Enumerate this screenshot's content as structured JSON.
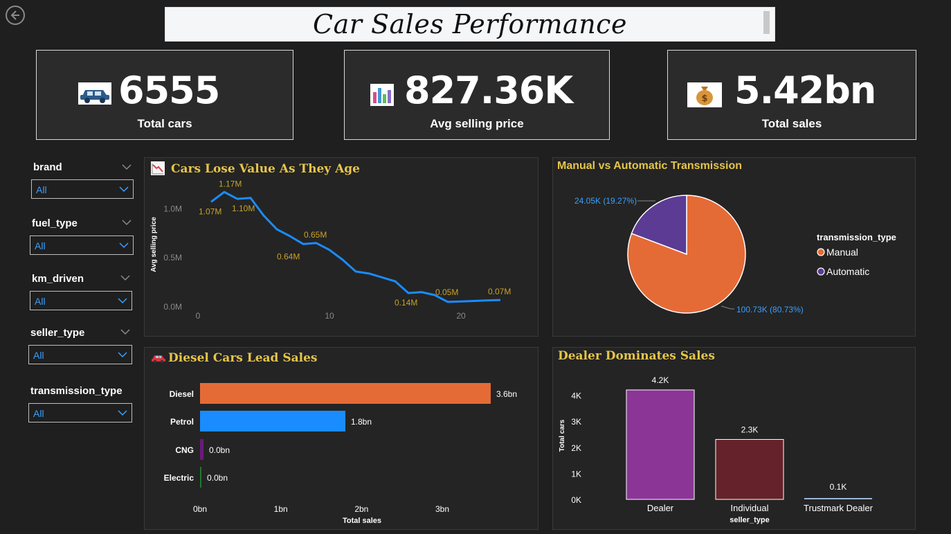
{
  "header": {
    "title": "Car Sales Performance"
  },
  "kpis": [
    {
      "icon": "car-icon",
      "value": "6555",
      "label": "Total cars"
    },
    {
      "icon": "bar-chart-icon",
      "value": "827.36K",
      "label": "Avg selling price"
    },
    {
      "icon": "money-bag-icon",
      "value": "5.42bn",
      "label": "Total sales"
    }
  ],
  "slicers": [
    {
      "label": "brand",
      "value": "All"
    },
    {
      "label": "fuel_type",
      "value": "All"
    },
    {
      "label": "km_driven",
      "value": "All"
    },
    {
      "label": "seller_type",
      "value": "All"
    },
    {
      "label": "transmission_type",
      "value": "All"
    }
  ],
  "colors": {
    "accent_title": "#e6c54a",
    "line": "#1a8cff",
    "orange": "#e56b36",
    "purple": "#5b3b94",
    "dealer": "#8b3597",
    "individual": "#66222a",
    "slicer_value": "#3aa0ff"
  },
  "chart_data": [
    {
      "type": "line",
      "title": "Cars Lose Value As They Age",
      "ylabel": "Avg selling price",
      "xlabel": "",
      "x_ticks": [
        "0",
        "10",
        "20"
      ],
      "y_ticks": [
        "0.0M",
        "0.5M",
        "1.0M"
      ],
      "xlim": [
        -1,
        24
      ],
      "ylim": [
        0,
        1.2
      ],
      "series": [
        {
          "x": [
            1,
            2,
            3,
            4,
            5,
            6,
            7,
            8,
            9,
            10,
            11,
            12,
            13,
            14,
            15,
            16,
            17,
            18,
            19,
            20,
            21,
            22,
            23
          ],
          "y": [
            1.07,
            1.17,
            1.1,
            1.11,
            0.93,
            0.79,
            0.72,
            0.64,
            0.65,
            0.58,
            0.48,
            0.36,
            0.34,
            0.3,
            0.26,
            0.14,
            0.15,
            0.12,
            0.05,
            0.055,
            0.06,
            0.065,
            0.07
          ]
        }
      ],
      "data_labels": [
        {
          "x": 1,
          "y": 1.07,
          "text": "1.07M"
        },
        {
          "x": 2,
          "y": 1.17,
          "text": "1.17M"
        },
        {
          "x": 3,
          "y": 1.1,
          "text": "1.10M"
        },
        {
          "x": 9,
          "y": 0.65,
          "text": "0.65M"
        },
        {
          "x": 8,
          "y": 0.64,
          "text": "0.64M"
        },
        {
          "x": 16,
          "y": 0.14,
          "text": "0.14M"
        },
        {
          "x": 19,
          "y": 0.05,
          "text": "0.05M"
        },
        {
          "x": 23,
          "y": 0.07,
          "text": "0.07M"
        }
      ]
    },
    {
      "type": "pie",
      "title": "Manual vs Automatic Transmission",
      "legend_title": "transmission_type",
      "legend_position": "right",
      "slices": [
        {
          "name": "Manual",
          "value": 100.73,
          "label": "100.73K (80.73%)",
          "color": "#e56b36"
        },
        {
          "name": "Automatic",
          "value": 24.05,
          "label": "24.05K (19.27%)",
          "color": "#5b3b94"
        }
      ]
    },
    {
      "type": "bar",
      "orientation": "horizontal",
      "title": "Diesel Cars Lead Sales",
      "xlabel": "Total sales",
      "categories": [
        "Diesel",
        "Petrol",
        "CNG",
        "Electric"
      ],
      "values": [
        3.6,
        1.8,
        0.02,
        0.0
      ],
      "value_labels": [
        "3.6bn",
        "1.8bn",
        "0.0bn",
        "0.0bn"
      ],
      "bar_colors": [
        "#e56b36",
        "#1a8cff",
        "#6a1b7a",
        "#1e7a2e"
      ],
      "x_ticks": [
        "0bn",
        "1bn",
        "2bn",
        "3bn"
      ],
      "xlim": [
        0,
        3.6
      ]
    },
    {
      "type": "bar",
      "title": "Dealer Dominates Sales",
      "xlabel": "seller_type",
      "ylabel": "Total cars",
      "categories": [
        "Dealer",
        "Individual",
        "Trustmark Dealer"
      ],
      "values": [
        4.2,
        2.3,
        0.1
      ],
      "value_labels": [
        "4.2K",
        "2.3K",
        "0.1K"
      ],
      "bar_colors": [
        "#8b3597",
        "#66222a",
        "#9bb5d6"
      ],
      "y_ticks": [
        "0K",
        "1K",
        "2K",
        "3K",
        "4K"
      ],
      "ylim": [
        0,
        4.2
      ]
    }
  ]
}
